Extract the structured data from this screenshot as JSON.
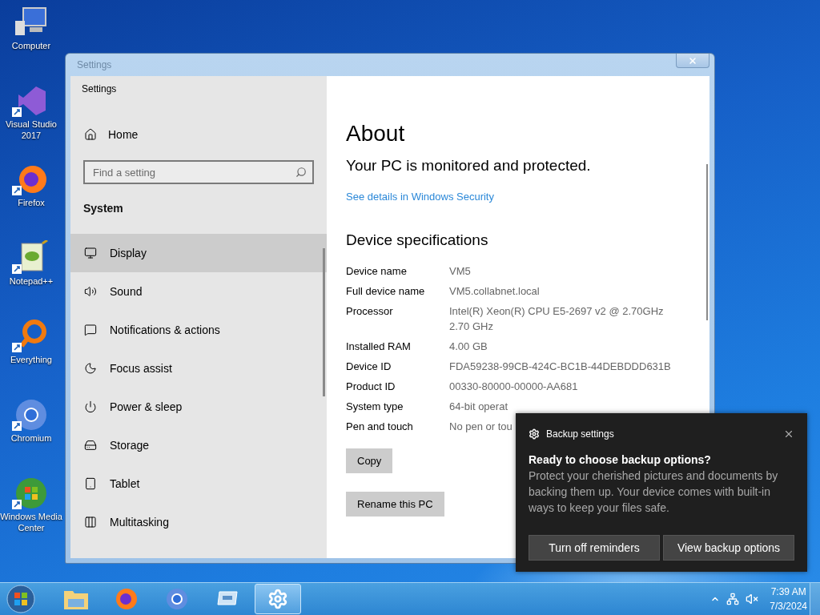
{
  "desktop_icons": [
    {
      "label": "Computer",
      "kind": "computer"
    },
    {
      "label": "Visual Studio 2017",
      "kind": "vs"
    },
    {
      "label": "Firefox",
      "kind": "firefox"
    },
    {
      "label": "Notepad++",
      "kind": "notepad"
    },
    {
      "label": "Everything",
      "kind": "everything"
    },
    {
      "label": "Chromium",
      "kind": "chromium"
    },
    {
      "label": "Windows Media Center",
      "kind": "wmc"
    }
  ],
  "window": {
    "title": "Settings",
    "app_title": "Settings"
  },
  "sidebar": {
    "home": "Home",
    "search": {
      "placeholder": "Find a setting"
    },
    "section": "System",
    "items": [
      {
        "label": "Display",
        "kind": "display",
        "selected": true
      },
      {
        "label": "Sound",
        "kind": "sound",
        "selected": false
      },
      {
        "label": "Notifications & actions",
        "kind": "notifications",
        "selected": false
      },
      {
        "label": "Focus assist",
        "kind": "moon",
        "selected": false
      },
      {
        "label": "Power & sleep",
        "kind": "power",
        "selected": false
      },
      {
        "label": "Storage",
        "kind": "storage",
        "selected": false
      },
      {
        "label": "Tablet",
        "kind": "tablet",
        "selected": false
      },
      {
        "label": "Multitasking",
        "kind": "multitasking",
        "selected": false
      }
    ]
  },
  "content": {
    "title": "About",
    "status": "Your PC is monitored and protected.",
    "link": "See details in Windows Security",
    "specs_title": "Device specifications",
    "specs": [
      {
        "label": "Device name",
        "value": "VM5"
      },
      {
        "label": "Full device name",
        "value": "VM5.collabnet.local"
      },
      {
        "label": "Processor",
        "value": "Intel(R) Xeon(R) CPU E5-2697 v2 @ 2.70GHz 2.70 GHz"
      },
      {
        "label": "Installed RAM",
        "value": "4.00 GB"
      },
      {
        "label": "Device ID",
        "value": "FDA59238-99CB-424C-BC1B-44DEBDDD631B"
      },
      {
        "label": "Product ID",
        "value": "00330-80000-00000-AA681"
      },
      {
        "label": "System type",
        "value": "64-bit operat"
      },
      {
        "label": "Pen and touch",
        "value": "No pen or tou"
      }
    ],
    "buttons": [
      "Copy",
      "Rename this PC"
    ]
  },
  "toast": {
    "app": "Backup settings",
    "title": "Ready to choose backup options?",
    "body": "Protect your cherished pictures and documents by backing them up. Your device comes with built-in ways to keep your files safe.",
    "buttons": [
      "Turn off reminders",
      "View backup options"
    ]
  },
  "taskbar": {
    "apps": [
      {
        "kind": "explorer",
        "selected": false
      },
      {
        "kind": "firefox",
        "selected": false
      },
      {
        "kind": "chromium",
        "selected": false
      },
      {
        "kind": "remote",
        "selected": false
      },
      {
        "kind": "settings",
        "selected": true
      }
    ],
    "time": "7:39 AM",
    "date": "7/3/2024"
  }
}
